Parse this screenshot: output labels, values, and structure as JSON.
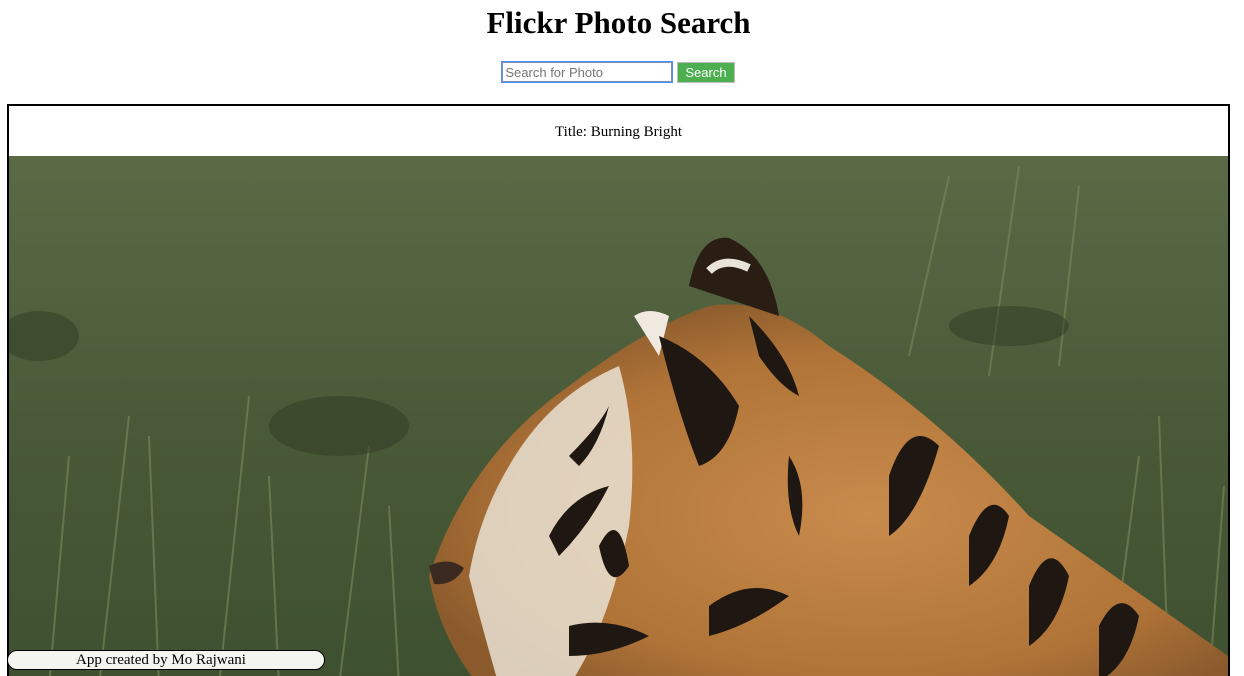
{
  "header": {
    "title": "Flickr Photo Search"
  },
  "search": {
    "placeholder": "Search for Photo",
    "value": "",
    "button_label": "Search",
    "button_color": "#4caf50"
  },
  "photo": {
    "title_text": "Title: Burning Bright",
    "subject": "tiger-in-grass-photo"
  },
  "footer": {
    "credit": "App created by Mo Rajwani"
  }
}
